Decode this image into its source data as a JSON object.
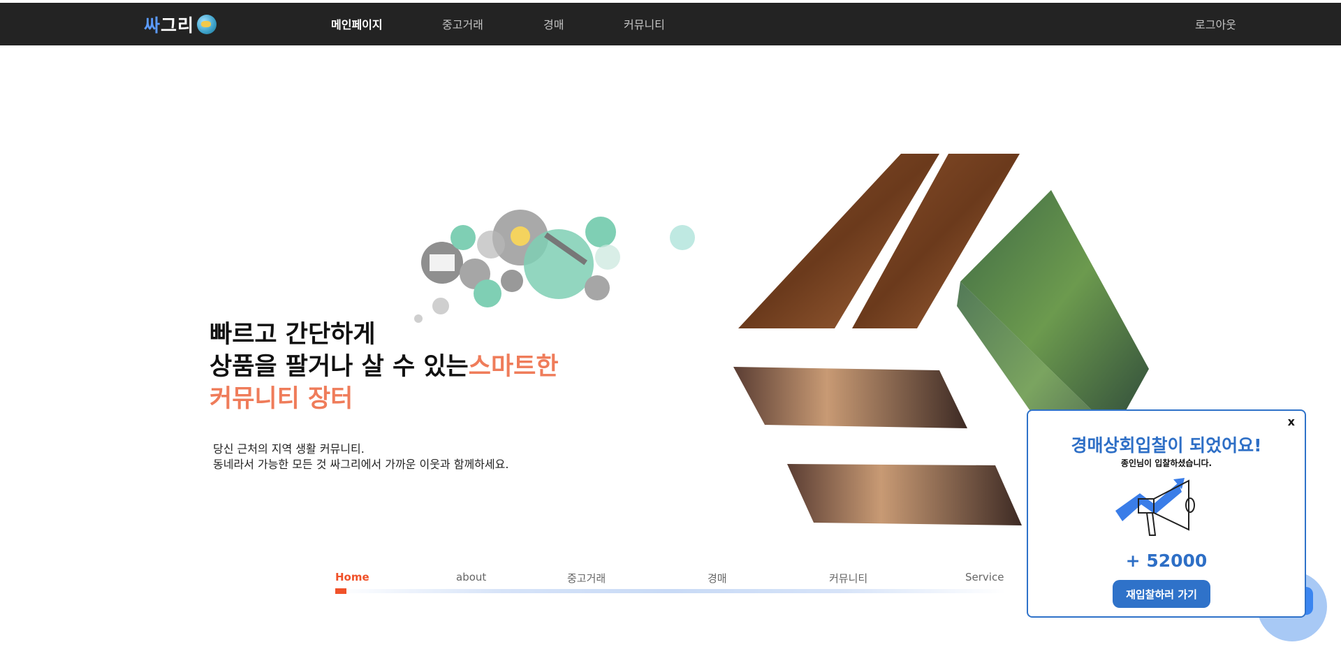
{
  "header": {
    "logo_text_part1": "싸",
    "logo_text_part2": "그리",
    "nav": [
      {
        "label": "메인페이지",
        "active": true
      },
      {
        "label": "중고거래",
        "active": false
      },
      {
        "label": "경매",
        "active": false
      },
      {
        "label": "커뮤니티",
        "active": false
      }
    ],
    "logout_label": "로그아웃"
  },
  "hero": {
    "headline_line1": "빠르고 간단하게",
    "headline_line2_plain": "상품을 팔거나 살 수 있는",
    "headline_line2_accent": "스마트한",
    "headline_line3_accent": "커뮤니티 장터",
    "sub_line1": "당신 근처의 지역 생활 커뮤니티.",
    "sub_line2": "동네라서 가능한 모든 것 싸그리에서 가까운 이웃과 함께하세요."
  },
  "section_tabs": [
    {
      "label": "Home",
      "active": true
    },
    {
      "label": "about",
      "active": false
    },
    {
      "label": "중고거래",
      "active": false
    },
    {
      "label": "경매",
      "active": false
    },
    {
      "label": "커뮤니티",
      "active": false
    },
    {
      "label": "Service",
      "active": false
    }
  ],
  "popup": {
    "close_label": "x",
    "title": "경매상회입찰이 되었어요!",
    "subtitle": "종인님이 입찰하셨습니다.",
    "amount": "+ 52000",
    "button_label": "재입찰하러 가기",
    "art_icon": "megaphone-growth-icon"
  },
  "colors": {
    "nav_bg": "#232323",
    "accent_orange": "#ef7c5a",
    "tab_active": "#f0522a",
    "popup_blue": "#2e6fc6"
  }
}
